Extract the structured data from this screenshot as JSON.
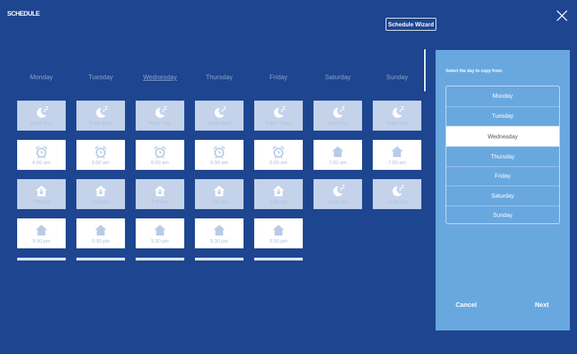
{
  "header": {
    "title": "SCHEDULE",
    "wizard_label": "Schedule Wizard"
  },
  "days": [
    "Monday",
    "Tuesday",
    "Wednesday",
    "Thursday",
    "Friday",
    "Saturday",
    "Sunday"
  ],
  "active_day": "Wednesday",
  "schedule_rows": [
    [
      {
        "icon": "moon-icon",
        "text": "From Sun",
        "style": "light"
      },
      {
        "icon": "moon-icon",
        "text": "From Mon",
        "style": "light"
      },
      {
        "icon": "moon-icon",
        "text": "From Tue",
        "style": "light"
      },
      {
        "icon": "moon-icon",
        "text": "From Wed",
        "style": "light"
      },
      {
        "icon": "moon-icon",
        "text": "From Thurs",
        "style": "light"
      },
      {
        "icon": "moon-icon",
        "text": "From Fri",
        "style": "light"
      },
      {
        "icon": "moon-icon",
        "text": "From Sat",
        "style": "light"
      }
    ],
    [
      {
        "icon": "alarm-clock-icon",
        "text": "6:00 am",
        "style": "white"
      },
      {
        "icon": "alarm-clock-icon",
        "text": "6:00 am",
        "style": "white"
      },
      {
        "icon": "alarm-clock-icon",
        "text": "6:00 am",
        "style": "white"
      },
      {
        "icon": "alarm-clock-icon",
        "text": "6:00 am",
        "style": "white"
      },
      {
        "icon": "alarm-clock-icon",
        "text": "6:00 am",
        "style": "white"
      },
      {
        "icon": "home-icon",
        "text": "7:00 am",
        "style": "white"
      },
      {
        "icon": "home-icon",
        "text": "7:00 am",
        "style": "white"
      }
    ],
    [
      {
        "icon": "away-home-icon",
        "text": "7:30 am",
        "style": "light"
      },
      {
        "icon": "away-home-icon",
        "text": "7:30 am",
        "style": "light"
      },
      {
        "icon": "away-home-icon",
        "text": "7:30 am",
        "style": "light"
      },
      {
        "icon": "away-home-icon",
        "text": "7:30 am",
        "style": "light"
      },
      {
        "icon": "away-home-icon",
        "text": "7:30 am",
        "style": "light"
      },
      {
        "icon": "moon-icon",
        "text": "10:30 pm",
        "style": "light"
      },
      {
        "icon": "moon-icon",
        "text": "10:30 pm",
        "style": "light"
      }
    ],
    [
      {
        "icon": "home-icon",
        "text": "5:30 pm",
        "style": "white"
      },
      {
        "icon": "home-icon",
        "text": "5:30 pm",
        "style": "white"
      },
      {
        "icon": "home-icon",
        "text": "5:30 pm",
        "style": "white"
      },
      {
        "icon": "home-icon",
        "text": "5:30 pm",
        "style": "white"
      },
      {
        "icon": "home-icon",
        "text": "5:30 pm",
        "style": "white"
      }
    ]
  ],
  "panel": {
    "prompt": "Select the day to copy from:",
    "days": [
      "Monday",
      "Tuesday",
      "Wednesday",
      "Thursday",
      "Friday",
      "Saturday",
      "Sunday"
    ],
    "selected": "Wednesday",
    "cancel_label": "Cancel",
    "next_label": "Next"
  },
  "colors": {
    "background": "#1d4590",
    "panel": "#69a8df",
    "tile_light": "#c4d3ea",
    "tile_white": "#ffffff"
  }
}
